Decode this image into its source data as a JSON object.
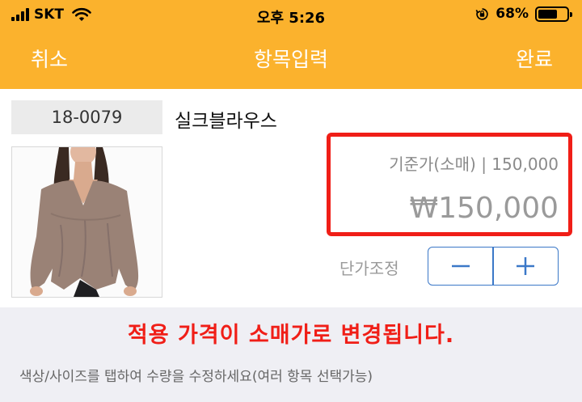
{
  "status_bar": {
    "carrier": "SKT",
    "time": "오후 5:26",
    "battery_percent": "68%",
    "battery_level": 0.68,
    "icons": [
      "signal-icon",
      "wifi-icon",
      "rotation-lock-icon",
      "battery-icon"
    ]
  },
  "nav": {
    "cancel_label": "취소",
    "title": "항목입력",
    "done_label": "완료"
  },
  "product": {
    "code": "18-0079",
    "name": "실크블라우스"
  },
  "price": {
    "base_label": "기준가(소매) | 150,000",
    "applied_value": "₩150,000"
  },
  "adjust": {
    "label": "단가조정",
    "minus_icon": "minus-icon",
    "plus_icon": "plus-icon"
  },
  "callout": {
    "text": "적용 가격이 소매가로 변경됩니다."
  },
  "hint": {
    "text": "색상/사이즈를 탭하여 수량을 수정하세요(여러 항목 선택가능)"
  },
  "colors": {
    "brand": "#fbb22d",
    "highlight": "#f01e17",
    "accent": "#3b78c8",
    "panel": "#efeff4"
  }
}
